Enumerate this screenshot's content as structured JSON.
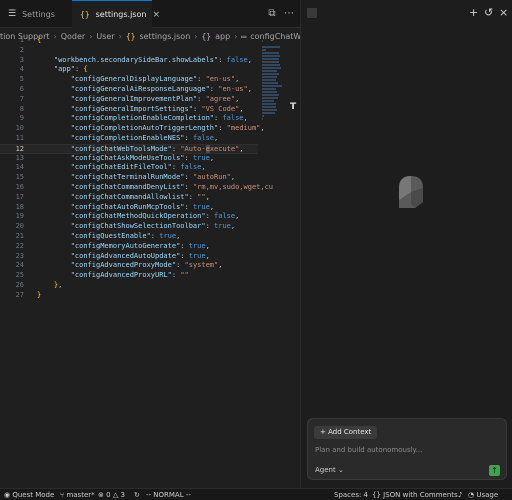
{
  "tabs": [
    {
      "label": "Settings",
      "icon": "gear-icon"
    },
    {
      "label": "settings.json",
      "icon": "json-braces-icon",
      "active": true
    }
  ],
  "breadcrumb": [
    "tion Support",
    "Qoder",
    "User",
    "settings.json",
    "app",
    "configChatWebToolsMode"
  ],
  "code_lines": [
    {
      "n": "1",
      "html": "<span class='br'>{</span>"
    },
    {
      "n": "2",
      "html": ""
    },
    {
      "n": "3",
      "html": "    <span class='k'>\"workbench.secondarySideBar.showLabels\"</span><span class='p'>: </span><span class='b'>false</span><span class='p'>,</span>"
    },
    {
      "n": "4",
      "html": "    <span class='k'>\"app\"</span><span class='p'>: </span><span class='br'>{</span>"
    },
    {
      "n": "5",
      "html": "        <span class='k'>\"configGeneralDisplayLanguage\"</span><span class='p'>: </span><span class='s'>\"en-us\"</span><span class='p'>,</span>"
    },
    {
      "n": "6",
      "html": "        <span class='k'>\"configGeneralAiResponseLanguage\"</span><span class='p'>: </span><span class='s'>\"en-us\"</span><span class='p'>,</span>"
    },
    {
      "n": "7",
      "html": "        <span class='k'>\"configGeneralImprovementPlan\"</span><span class='p'>: </span><span class='s'>\"agree\"</span><span class='p'>,</span>"
    },
    {
      "n": "8",
      "html": "        <span class='k'>\"configGeneralImportSettings\"</span><span class='p'>: </span><span class='s'>\"VS Code\"</span><span class='p'>,</span>"
    },
    {
      "n": "9",
      "html": "        <span class='k'>\"configCompletionEnableCompletion\"</span><span class='p'>: </span><span class='b'>false</span><span class='p'>,</span>"
    },
    {
      "n": "10",
      "html": "        <span class='k'>\"configCompletionAutoTriggerLength\"</span><span class='p'>: </span><span class='s'>\"medium\"</span><span class='p'>,</span>"
    },
    {
      "n": "11",
      "html": "        <span class='k'>\"configCompletionEnableNES\"</span><span class='p'>: </span><span class='b'>false</span><span class='p'>,</span>"
    },
    {
      "n": "12",
      "html": "        <span class='k'>\"configChatWebToolsMode\"</span><span class='p'>: </span><span class='s'>\"Auto-</span><span class='cursor-hl'>e</span><span class='s'>xecute\"</span><span class='p'>,</span>",
      "current": true
    },
    {
      "n": "13",
      "html": "        <span class='k'>\"configChatAskModeUseTools\"</span><span class='p'>: </span><span class='b'>true</span><span class='p'>,</span>"
    },
    {
      "n": "14",
      "html": "        <span class='k'>\"configChatEditFileTool\"</span><span class='p'>: </span><span class='b'>false</span><span class='p'>,</span>"
    },
    {
      "n": "15",
      "html": "        <span class='k'>\"configChatTerminalRunMode\"</span><span class='p'>: </span><span class='s'>\"autoRun\"</span><span class='p'>,</span>"
    },
    {
      "n": "16",
      "html": "        <span class='k'>\"configChatCommandDenyList\"</span><span class='p'>: </span><span class='s'>\"rm,mv,sudo,wget,cu</span>"
    },
    {
      "n": "17",
      "html": "        <span class='k'>\"configChatCommandAllowlist\"</span><span class='p'>: </span><span class='s'>\"\"</span><span class='p'>,</span>"
    },
    {
      "n": "18",
      "html": "        <span class='k'>\"configChatAutoRunMcpTools\"</span><span class='p'>: </span><span class='b'>true</span><span class='p'>,</span>"
    },
    {
      "n": "19",
      "html": "        <span class='k'>\"configChatMethodQuickOperation\"</span><span class='p'>: </span><span class='b'>false</span><span class='p'>,</span>"
    },
    {
      "n": "20",
      "html": "        <span class='k'>\"configChatShowSelectionToolbar\"</span><span class='p'>: </span><span class='b'>true</span><span class='p'>,</span>"
    },
    {
      "n": "21",
      "html": "        <span class='k'>\"configQuestEnable\"</span><span class='p'>: </span><span class='b'>true</span><span class='p'>,</span>"
    },
    {
      "n": "22",
      "html": "        <span class='k'>\"configMemoryAutoGenerate\"</span><span class='p'>: </span><span class='b'>true</span><span class='p'>,</span>"
    },
    {
      "n": "23",
      "html": "        <span class='k'>\"configAdvancedAutoUpdate\"</span><span class='p'>: </span><span class='b'>true</span><span class='p'>,</span>"
    },
    {
      "n": "24",
      "html": "        <span class='k'>\"configAdvancedProxyMode\"</span><span class='p'>: </span><span class='s'>\"system\"</span><span class='p'>,</span>"
    },
    {
      "n": "25",
      "html": "        <span class='k'>\"configAdvancedProxyURL\"</span><span class='p'>: </span><span class='s'>\"\"</span>"
    },
    {
      "n": "26",
      "html": "    <span class='br'>}</span><span class='p'>,</span>"
    },
    {
      "n": "27",
      "html": "<span class='br'>}</span>"
    }
  ],
  "chat": {
    "add_context_label": "+ Add Context",
    "placeholder": "Plan and build autonomously...",
    "mode_label": "Agent",
    "icons": [
      "plus-icon",
      "history-icon",
      "close-icon"
    ]
  },
  "statusbar": {
    "quest_mode": "Quest Mode",
    "branch": "master*",
    "problems": "0",
    "warnings": "3",
    "vim_mode": "-- NORMAL --",
    "spaces": "Spaces: 4",
    "language": "JSON with Comments",
    "usage": "Usage"
  },
  "colors": {
    "editor_bg": "#1f1f1f",
    "key": "#9cdcfe",
    "string": "#ce9178",
    "boolean": "#569cd6",
    "brace": "#ffd700",
    "send_button": "#3fa34d"
  }
}
